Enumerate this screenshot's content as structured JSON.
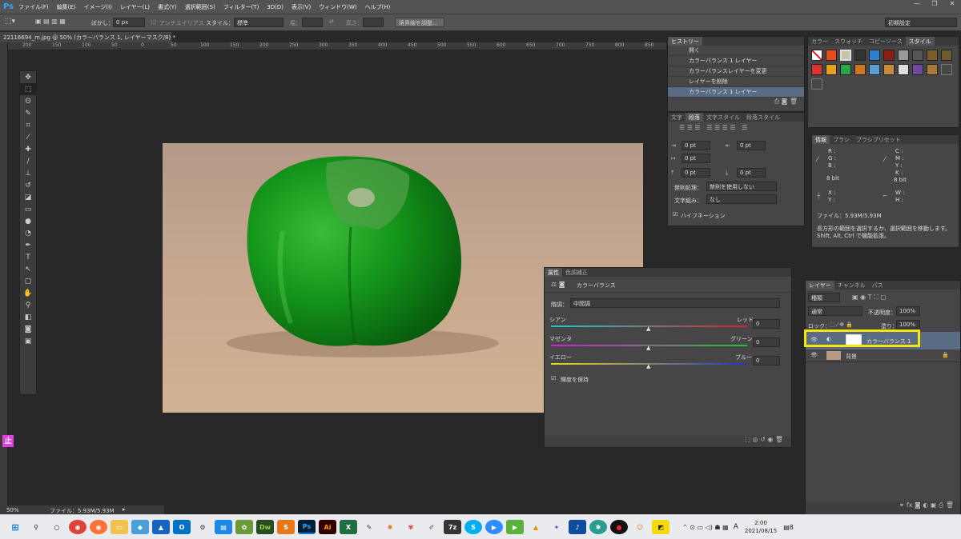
{
  "app": {
    "logo": "Ps"
  },
  "menu": [
    "ファイル(F)",
    "編集(E)",
    "イメージ(I)",
    "レイヤー(L)",
    "書式(Y)",
    "選択範囲(S)",
    "フィルター(T)",
    "3D(D)",
    "表示(V)",
    "ウィンドウ(W)",
    "ヘルプ(H)"
  ],
  "options": {
    "feather_label": "ぼかし：",
    "feather_value": "0 px",
    "antialias": "アンチエイリアス",
    "style_label": "スタイル：",
    "style_value": "標準",
    "width_label": "幅：",
    "height_label": "高さ：",
    "refine_button": "境界線を調整...",
    "workspace": "初期設定"
  },
  "document": {
    "tab": "22116694_m.jpg @ 50% (カラーバランス 1, レイヤーマスク/8) *"
  },
  "ruler_top": [
    "200",
    "150",
    "100",
    "50",
    "0",
    "50",
    "100",
    "150",
    "200",
    "250",
    "300",
    "350",
    "400",
    "450",
    "500",
    "550",
    "600",
    "650",
    "700",
    "750",
    "800",
    "850",
    "900"
  ],
  "history": {
    "tab": "ヒストリー",
    "items": [
      "開く",
      "カラーバランス 1 レイヤー",
      "カラーバランスレイヤーを変更",
      "レイヤーを削除",
      "カラーバランス 1 レイヤー"
    ]
  },
  "paragraph": {
    "tabs": [
      "文字",
      "段落",
      "文字スタイル",
      "段落スタイル"
    ],
    "indent_left": "0 pt",
    "indent_right": "0 pt",
    "indent_first": "0 pt",
    "space_before": "0 pt",
    "space_after": "0 pt",
    "kinsoku_label": "禁則処理：",
    "kinsoku_value": "禁則を使用しない",
    "mojikumi_label": "文字組み：",
    "mojikumi_value": "なし",
    "hyphenation": "ハイフネーション"
  },
  "swatch_tabs": [
    "カラー",
    "スウォッチ",
    "スタイル",
    "コピーソース"
  ],
  "info": {
    "tabs": [
      "情報",
      "ブラシ",
      "ブラシプリセット"
    ],
    "rgb": [
      "R :",
      "G :",
      "B :"
    ],
    "cmyk": [
      "C :",
      "M :",
      "Y :",
      "K :"
    ],
    "bit1": "8 bit",
    "bit2": "8 bit",
    "x": "X :",
    "y": "Y :",
    "w": "W :",
    "h": "H :",
    "file": "ファイル：5.93M/5.93M",
    "hint": "長方形の範囲を選択するか、選択範囲を移動します。Shift, Alt, Ctrl で機能拡張。"
  },
  "properties": {
    "tabs": [
      "属性",
      "色調補正"
    ],
    "title": "カラーバランス",
    "tone_label": "階調：",
    "tone_value": "中間調",
    "sliders": [
      {
        "left": "シアン",
        "right": "レッド",
        "value": "0"
      },
      {
        "left": "マゼンタ",
        "right": "グリーン",
        "value": "0"
      },
      {
        "left": "イエロー",
        "right": "ブルー",
        "value": "0"
      }
    ],
    "preserve": "輝度を保持"
  },
  "layers": {
    "tabs": [
      "レイヤー",
      "チャンネル",
      "パス"
    ],
    "kind": "種類",
    "blend": "通常",
    "opacity_label": "不透明度：",
    "opacity_value": "100%",
    "lock_label": "ロック：",
    "fill_label": "塗り：",
    "fill_value": "100%",
    "rows": [
      "カラーバランス 1",
      "背景"
    ]
  },
  "status": {
    "zoom": "50%",
    "file": "ファイル：5.93M/5.93M"
  },
  "side_badge": "止",
  "taskbar": {
    "time": "2:00",
    "date": "2021/08/15",
    "ime": "A",
    "notif": "8"
  },
  "colors": {
    "accent": "#31a8ff",
    "highlight": "#f5e50a",
    "selected": "#5a6b85"
  }
}
